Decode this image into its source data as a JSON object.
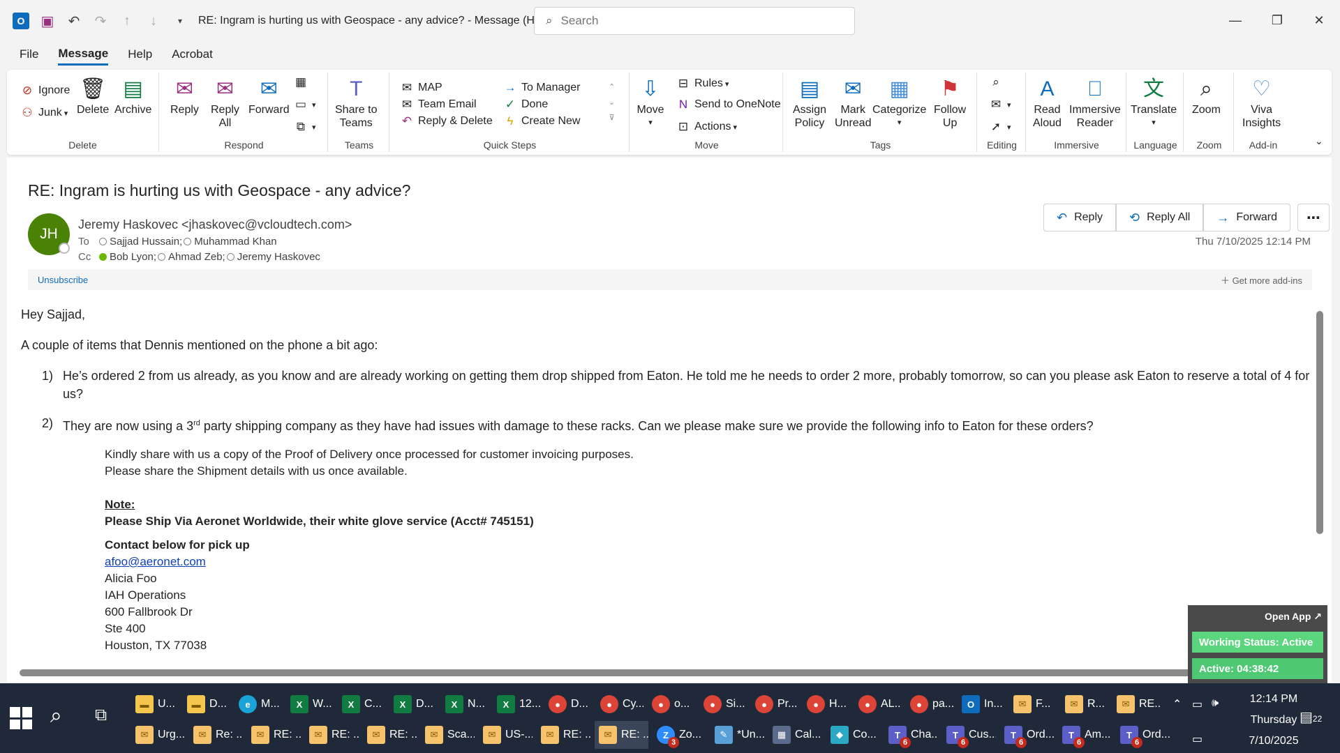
{
  "titlebar": {
    "title": "RE: Ingram is hurting us with Geospace - any advice?  -  Message (HT...",
    "search_placeholder": "Search"
  },
  "menu": {
    "tabs": [
      "File",
      "Message",
      "Help",
      "Acrobat"
    ],
    "active": "Message"
  },
  "ribbon": {
    "delete": {
      "label": "Delete",
      "ignore": "Ignore",
      "junk": "Junk",
      "delete": "Delete",
      "archive": "Archive"
    },
    "respond": {
      "label": "Respond",
      "reply": "Reply",
      "reply_all_1": "Reply",
      "reply_all_2": "All",
      "forward": "Forward"
    },
    "teams": {
      "label": "Teams",
      "share_1": "Share to",
      "share_2": "Teams"
    },
    "quicksteps": {
      "label": "Quick Steps",
      "items": [
        "MAP",
        "Team Email",
        "Reply & Delete",
        "To Manager",
        "Done",
        "Create New"
      ]
    },
    "move": {
      "label": "Move",
      "move": "Move",
      "rules": "Rules",
      "onenote": "Send to OneNote",
      "actions": "Actions"
    },
    "tags": {
      "label": "Tags",
      "assign_1": "Assign",
      "assign_2": "Policy",
      "mark_1": "Mark",
      "mark_2": "Unread",
      "categorize": "Categorize",
      "follow_1": "Follow",
      "follow_2": "Up"
    },
    "editing": {
      "label": "Editing"
    },
    "immersive": {
      "label": "Immersive",
      "read_1": "Read",
      "read_2": "Aloud",
      "reader_1": "Immersive",
      "reader_2": "Reader"
    },
    "language": {
      "label": "Language",
      "translate": "Translate"
    },
    "zoom": {
      "label": "Zoom",
      "zoom": "Zoom"
    },
    "addin": {
      "label": "Add-in",
      "viva_1": "Viva",
      "viva_2": "Insights"
    }
  },
  "message": {
    "subject": "RE: Ingram is hurting us with Geospace - any advice?",
    "initials": "JH",
    "sender": "Jeremy Haskovec <jhaskovec@vcloudtech.com>",
    "to_label": "To",
    "to": [
      "Sajjad Hussain;",
      "Muhammad Khan"
    ],
    "cc_label": "Cc",
    "cc": [
      "Bob Lyon;",
      "Ahmad Zeb;",
      "Jeremy Haskovec"
    ],
    "datetime": "Thu 7/10/2025 12:14 PM",
    "actions": {
      "reply": "Reply",
      "reply_all": "Reply All",
      "forward": "Forward"
    },
    "unsubscribe": "Unsubscribe",
    "get_addins": "Get more add-ins",
    "body": {
      "greeting": "Hey Sajjad,",
      "intro": "A couple of items that Dennis mentioned on the phone a bit ago:",
      "item1_num": "1)",
      "item1": "He’s ordered 2 from us already, as you know and are already working on getting them drop shipped from Eaton.  He told me he needs to order 2 more, probably tomorrow, so can you please ask Eaton to reserve a total of 4 for us?",
      "item2_num": "2)",
      "item2_a": "They are now using a 3",
      "item2_sup": "rd",
      "item2_b": " party shipping company as they have had issues with damage to these racks.  Can we please make sure we provide the following info to Eaton for these orders?",
      "pod": "Kindly share with us a copy of the Proof of Delivery once processed for customer invoicing purposes.",
      "shipment": "Please share the Shipment details with us once available.",
      "note": "Note:",
      "ship_via": "Please Ship Via Aeronet Worldwide, their white glove service (Acct# 745151)",
      "contact": "Contact below for pick up",
      "email": "afoo@aeronet.com",
      "name": "Alicia Foo",
      "dept": "IAH Operations",
      "addr1": "600 Fallbrook Dr",
      "addr2": "Ste 400",
      "addr3": "Houston, TX 77038"
    }
  },
  "widget": {
    "open_app": "Open App ↗",
    "status": "Working Status: Active",
    "active": "Active: 04:38:42"
  },
  "taskbar": {
    "row1": [
      {
        "icon": "folder",
        "label": "U..."
      },
      {
        "icon": "folder",
        "label": "D..."
      },
      {
        "icon": "edge",
        "label": "M..."
      },
      {
        "icon": "excel",
        "label": "W..."
      },
      {
        "icon": "excel",
        "label": "C..."
      },
      {
        "icon": "excel",
        "label": "D..."
      },
      {
        "icon": "excel",
        "label": "N..."
      },
      {
        "icon": "excel",
        "label": "12..."
      },
      {
        "icon": "chrome",
        "label": "D..."
      },
      {
        "icon": "chrome",
        "label": "Cy..."
      },
      {
        "icon": "chrome",
        "label": "o..."
      },
      {
        "icon": "chrome",
        "label": "Si..."
      },
      {
        "icon": "chrome",
        "label": "Pr..."
      },
      {
        "icon": "chrome",
        "label": "H..."
      },
      {
        "icon": "chrome",
        "label": "AL..."
      },
      {
        "icon": "chrome",
        "label": "pa..."
      },
      {
        "icon": "outlook",
        "label": "In..."
      },
      {
        "icon": "mail",
        "label": "F..."
      },
      {
        "icon": "mail",
        "label": "R..."
      },
      {
        "icon": "mail",
        "label": "RE..."
      }
    ],
    "row2": [
      {
        "icon": "mail",
        "label": "Urg..."
      },
      {
        "icon": "mail",
        "label": "Re: ..."
      },
      {
        "icon": "mail",
        "label": "RE: ..."
      },
      {
        "icon": "mail",
        "label": "RE: ..."
      },
      {
        "icon": "mail",
        "label": "RE: ..."
      },
      {
        "icon": "mail",
        "label": "Sca..."
      },
      {
        "icon": "mail",
        "label": "US-..."
      },
      {
        "icon": "mail",
        "label": "RE: ..."
      },
      {
        "icon": "mail",
        "label": "RE: ..."
      },
      {
        "icon": "zoom",
        "label": "Zo...",
        "badge": "3"
      },
      {
        "icon": "note",
        "label": "*Un..."
      },
      {
        "icon": "calc",
        "label": "Cal..."
      },
      {
        "icon": "co",
        "label": "Co..."
      },
      {
        "icon": "teams",
        "label": "Cha...",
        "badge": "6"
      },
      {
        "icon": "teams",
        "label": "Cus...",
        "badge": "6"
      },
      {
        "icon": "teams",
        "label": "Ord...",
        "badge": "6"
      },
      {
        "icon": "teams",
        "label": "Am...",
        "badge": "6"
      },
      {
        "icon": "teams",
        "label": "Ord...",
        "badge": "6"
      }
    ],
    "time": "12:14 PM",
    "day": "Thursday",
    "date": "7/10/2025",
    "notifications": "22"
  }
}
